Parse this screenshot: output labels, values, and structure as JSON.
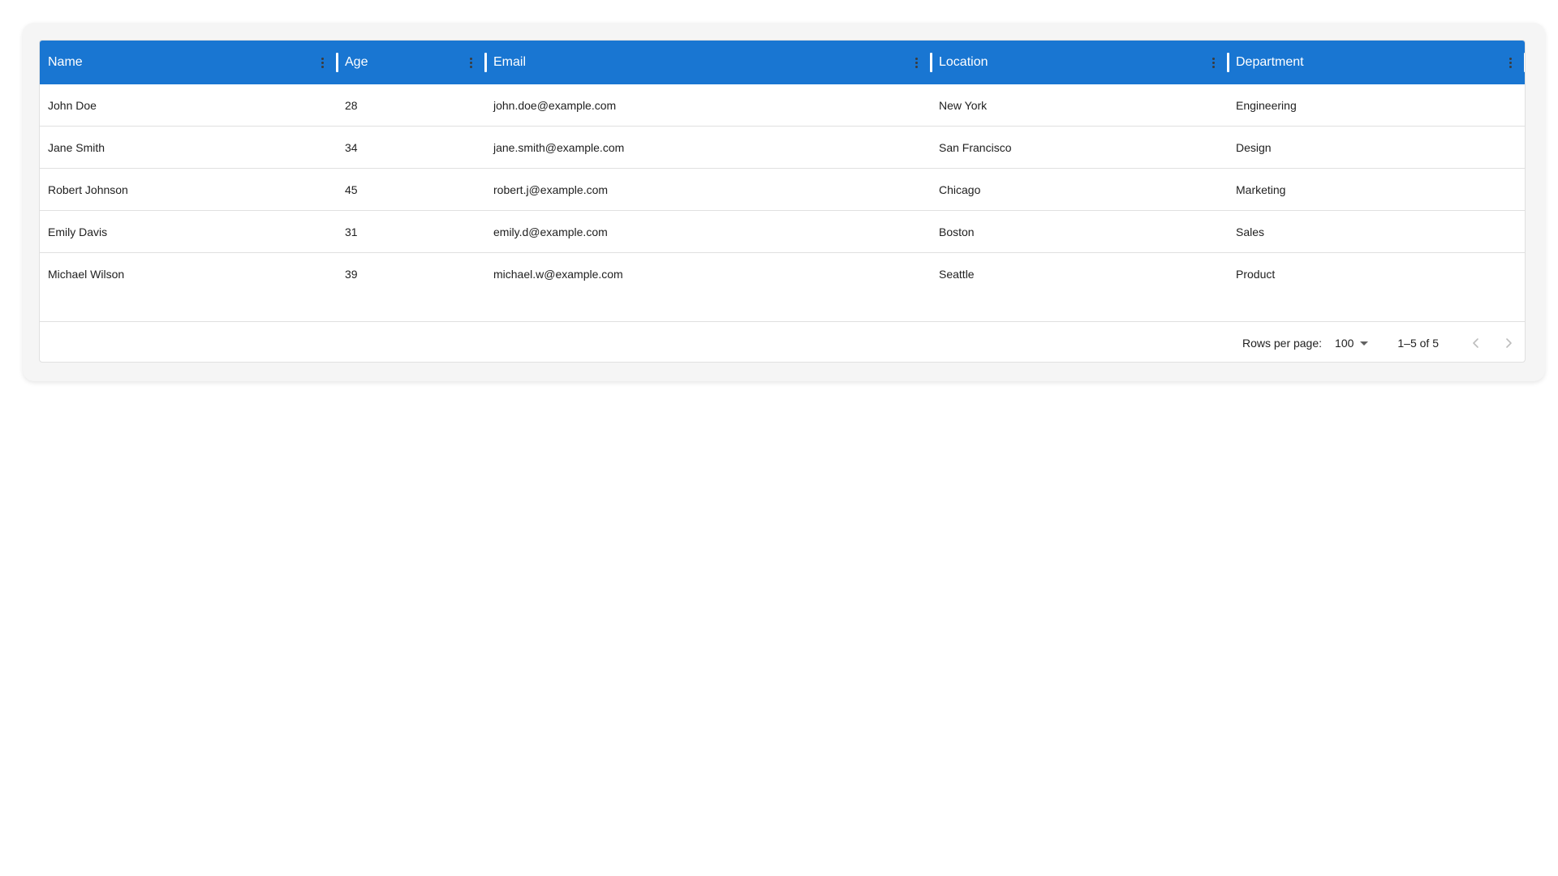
{
  "columns": [
    {
      "key": "name",
      "label": "Name"
    },
    {
      "key": "age",
      "label": "Age"
    },
    {
      "key": "email",
      "label": "Email"
    },
    {
      "key": "location",
      "label": "Location"
    },
    {
      "key": "department",
      "label": "Department"
    }
  ],
  "rows": [
    [
      "John Doe",
      "28",
      "john.doe@example.com",
      "New York",
      "Engineering"
    ],
    [
      "Jane Smith",
      "34",
      "jane.smith@example.com",
      "San Francisco",
      "Design"
    ],
    [
      "Robert Johnson",
      "45",
      "robert.j@example.com",
      "Chicago",
      "Marketing"
    ],
    [
      "Emily Davis",
      "31",
      "emily.d@example.com",
      "Boston",
      "Sales"
    ],
    [
      "Michael Wilson",
      "39",
      "michael.w@example.com",
      "Seattle",
      "Product"
    ]
  ],
  "footer": {
    "rows_per_page_label": "Rows per page:",
    "rows_per_page_value": "100",
    "range_text": "1–5 of 5"
  },
  "icons": {
    "column_menu": "more-vert-icon",
    "rows_per_page_dropdown": "arrow-drop-down-icon",
    "previous_page": "chevron-left-icon",
    "next_page": "chevron-right-icon"
  },
  "colors": {
    "header_background": "#1976d2",
    "header_text": "#ffffff",
    "card_background": "#f5f5f5",
    "border": "#e0e0e0",
    "disabled_icon": "#bdbdbd"
  }
}
